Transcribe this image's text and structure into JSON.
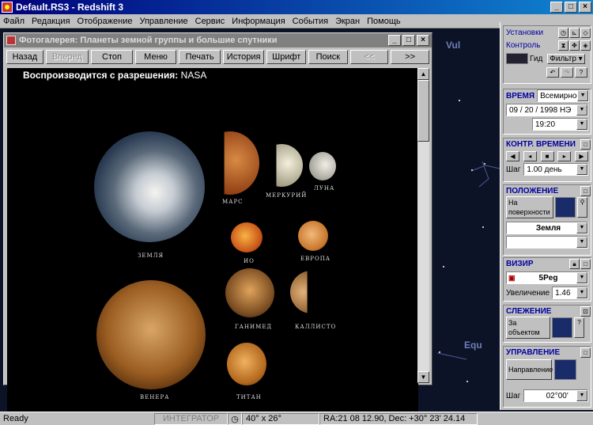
{
  "window": {
    "title": "Default.RS3 - Redshift 3"
  },
  "menu": [
    "Файл",
    "Редакция",
    "Отображение",
    "Управление",
    "Сервис",
    "Информация",
    "События",
    "Экран",
    "Помощь"
  ],
  "starfield": {
    "labels": [
      "Vul",
      "Equ"
    ]
  },
  "gallery": {
    "title": "Фотогалерея: Планеты земной группы и большие спутники",
    "buttons": [
      {
        "label": "Назад",
        "enabled": true
      },
      {
        "label": "Вперед",
        "enabled": false
      },
      {
        "label": "Стоп",
        "enabled": true
      },
      {
        "label": "Меню",
        "enabled": true
      },
      {
        "label": "Печать",
        "enabled": true
      },
      {
        "label": "История",
        "enabled": true
      },
      {
        "label": "Шрифт",
        "enabled": true
      },
      {
        "label": "Поиск",
        "enabled": true
      },
      {
        "label": "<<",
        "enabled": false
      },
      {
        "label": ">>",
        "enabled": true
      }
    ],
    "credit_label": "Воспроизводится с разрешения:",
    "credit_source": "NASA",
    "planets": [
      "ЗЕМЛЯ",
      "МАРС",
      "МЕРКУРИЙ",
      "ЛУНА",
      "ИО",
      "ЕВРОПА",
      "ГАНИМЕД",
      "КАЛЛИСТО",
      "ВЕНЕРА",
      "ТИТАН"
    ]
  },
  "panel": {
    "settings_label": "Установки",
    "control_label": "Контроль",
    "guide_label": "Гид",
    "filter_label": "Фильтр",
    "time": {
      "header": "ВРЕМЯ",
      "mode": "Всемирное",
      "date": "09 / 20 / 1998 НЭ",
      "clock": "19:20"
    },
    "time_control": {
      "header": "КОНТР. ВРЕМЕНИ",
      "step_label": "Шаг",
      "step_value": "1.00 день"
    },
    "position": {
      "header": "ПОЛОЖЕНИЕ",
      "mode": "На поверхности",
      "body": "Земля",
      "extra": ""
    },
    "view": {
      "header": "ВИЗИР",
      "target": "5Peg",
      "zoom_label": "Увеличение",
      "zoom_value": "1.46"
    },
    "tracking": {
      "header": "СЛЕЖЕНИЕ",
      "mode": "За объектом"
    },
    "control": {
      "header": "УПРАВЛЕНИЕ",
      "mode": "Направление",
      "step_label": "Шаг",
      "step_value": "02°00'"
    }
  },
  "status": {
    "ready": "Ready",
    "integrator": "ИНТЕГРАТОР",
    "fov": "40° x 26°",
    "coords": "RA:21 08 12.90, Dec: +30° 23' 24.14"
  }
}
